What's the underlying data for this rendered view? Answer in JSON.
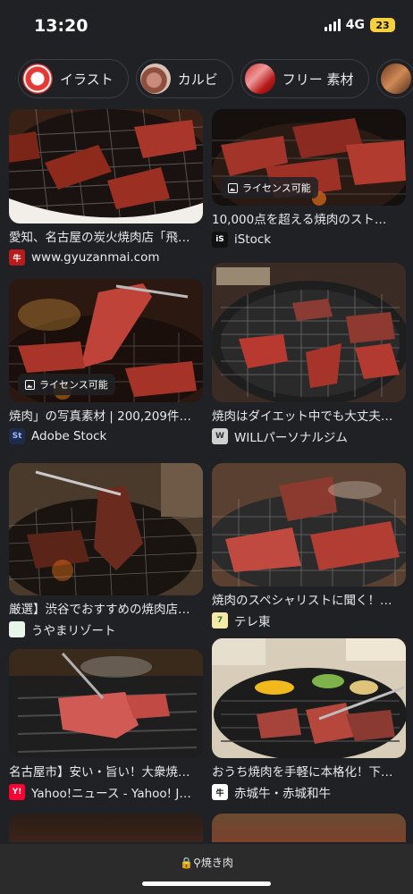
{
  "status": {
    "time": "13:20",
    "network": "4G",
    "battery": "23"
  },
  "chips": [
    {
      "label": "イラスト",
      "icon": "illustration-thumbnail",
      "color": "#c62828"
    },
    {
      "label": "カルビ",
      "icon": "kalbi-thumbnail",
      "color": "#a86b5a"
    },
    {
      "label": "フリー 素材",
      "icon": "free-material-thumbnail",
      "color": "#b71c1c"
    },
    {
      "label": "",
      "icon": "more-thumbnail",
      "color": "#8d4b2f"
    }
  ],
  "results": [
    {
      "title": "愛知、名古屋の炭火焼肉店「飛…",
      "source": "www.gyuzanmai.com",
      "favicon": "gyuzanmai-icon",
      "favicon_color": "#b71c1c",
      "favicon_text": "牛",
      "license": ""
    },
    {
      "title": "10,000点を超える焼肉のスト…",
      "source": "iStock",
      "favicon": "istock-icon",
      "favicon_color": "#111111",
      "favicon_text": "iS",
      "license": "ライセンス可能"
    },
    {
      "title": "焼肉」の写真素材 | 200,209件…",
      "source": "Adobe Stock",
      "favicon": "adobe-stock-icon",
      "favicon_color": "#1e2b4a",
      "favicon_text": "St",
      "license": "ライセンス可能"
    },
    {
      "title": "焼肉はダイエット中でも大丈夫…",
      "source": "WILLパーソナルジム",
      "favicon": "will-gym-icon",
      "favicon_color": "#d0d0d0",
      "favicon_text": "W",
      "license": ""
    },
    {
      "title": "厳選】渋谷でおすすめの焼肉店…",
      "source": "うやまリゾート",
      "favicon": "uyama-resort-icon",
      "favicon_color": "#e8f5e9",
      "favicon_text": "",
      "license": ""
    },
    {
      "title": "焼肉のスペシャリストに聞く！…",
      "source": "テレ東",
      "favicon": "tv-tokyo-icon",
      "favicon_color": "#f6e9a8",
      "favicon_text": "7",
      "license": ""
    },
    {
      "title": "名古屋市】安い・旨い！大衆焼…",
      "source": "Yahoo!ニュース - Yahoo! J…",
      "favicon": "yahoo-news-icon",
      "favicon_color": "#ff0033",
      "favicon_text": "Y!",
      "license": ""
    },
    {
      "title": "おうち焼肉を手軽に本格化！下…",
      "source": "赤城牛・赤城和牛",
      "favicon": "akagi-beef-icon",
      "favicon_color": "#ffffff",
      "favicon_text": "牛",
      "license": ""
    }
  ],
  "address_bar": {
    "text": "焼き肉"
  }
}
